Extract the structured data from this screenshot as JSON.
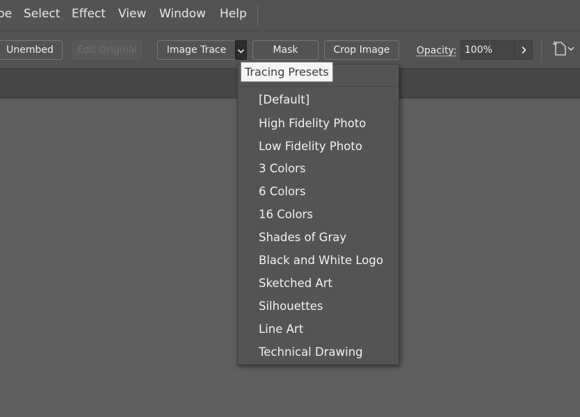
{
  "menubar": {
    "items": [
      {
        "label": "pe"
      },
      {
        "label": "Select"
      },
      {
        "label": "Effect"
      },
      {
        "label": "View"
      },
      {
        "label": "Window"
      },
      {
        "label": "Help"
      }
    ]
  },
  "controlbar": {
    "unembed_label": "Unembed",
    "edit_original_label": "Edit Original",
    "image_trace_label": "Image Trace",
    "mask_label": "Mask",
    "crop_image_label": "Crop Image",
    "opacity_label": "Opacity:",
    "opacity_value": "100%"
  },
  "tooltip": {
    "text": "Tracing Presets"
  },
  "presets": {
    "items": [
      {
        "label": "[Default]"
      },
      {
        "label": "High Fidelity Photo"
      },
      {
        "label": "Low Fidelity Photo"
      },
      {
        "label": "3 Colors"
      },
      {
        "label": "6 Colors"
      },
      {
        "label": "16 Colors"
      },
      {
        "label": "Shades of Gray"
      },
      {
        "label": "Black and White Logo"
      },
      {
        "label": "Sketched Art"
      },
      {
        "label": "Silhouettes"
      },
      {
        "label": "Line Art"
      },
      {
        "label": "Technical Drawing"
      }
    ]
  },
  "icons": {
    "dropdown": "chevron-down-icon",
    "opacity_more": "chevron-right-icon",
    "document": "document-setup-icon"
  }
}
